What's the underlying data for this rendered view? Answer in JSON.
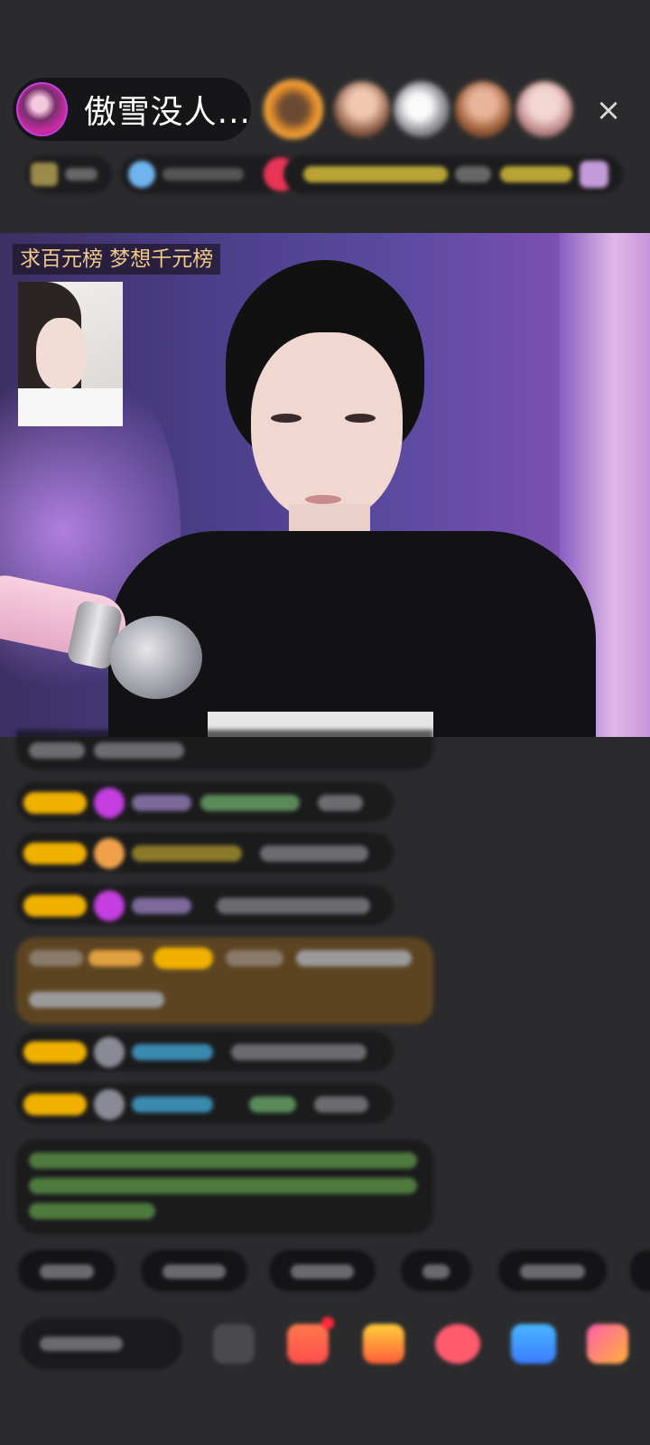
{
  "header": {
    "host_name": "傲雪没人...",
    "viewer_avatars": [
      "viewer-avatar-1",
      "viewer-avatar-2",
      "viewer-avatar-3",
      "viewer-avatar-4",
      "viewer-avatar-5"
    ],
    "close_icon": "×"
  },
  "stream": {
    "banner_text": "求百元榜  梦想千元榜"
  },
  "chat": {
    "messages": [
      {
        "type": "system"
      },
      {
        "type": "fan",
        "badge_color": "#f0b100",
        "icon": "diamond-icon"
      },
      {
        "type": "fan",
        "badge_color": "#f0b100",
        "icon": "hand-icon"
      },
      {
        "type": "fan",
        "badge_color": "#f0b100",
        "icon": "diamond-icon"
      },
      {
        "type": "highlight",
        "badge_color": "#f0b100"
      },
      {
        "type": "fan",
        "badge_color": "#f0b100",
        "icon": "avatar-icon"
      },
      {
        "type": "fan",
        "badge_color": "#f0b100",
        "icon": "avatar-icon"
      },
      {
        "type": "notice"
      }
    ]
  },
  "quick_replies": [
    "quick-reply-1",
    "quick-reply-2",
    "quick-reply-3",
    "quick-reply-4",
    "quick-reply-5"
  ],
  "toolbar": {
    "icons": [
      "emoji-icon",
      "gift-icon",
      "red-packet-icon",
      "heart-icon",
      "game-icon",
      "more-icon"
    ]
  },
  "colors": {
    "background": "#2b2b2d",
    "badge": "#f0b100",
    "banner_text": "#f0c98a",
    "viewer_ring": "#f7a63d"
  }
}
